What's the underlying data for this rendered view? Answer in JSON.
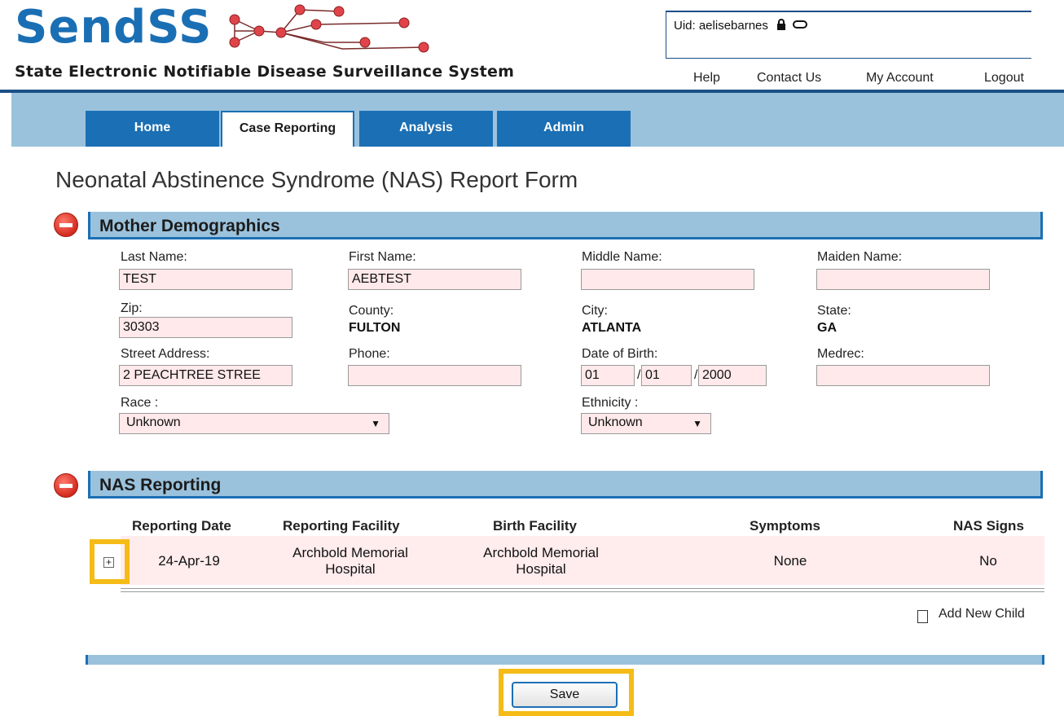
{
  "header": {
    "logo_text": "SendSS",
    "logo_subtitle": "State Electronic Notifiable Disease Surveillance System",
    "uid_label": "Uid: aelisebarnes",
    "links": [
      "Help",
      "Contact Us",
      "My Account",
      "Logout"
    ]
  },
  "nav": {
    "tabs": [
      {
        "label": "Home",
        "active": false
      },
      {
        "label": "Case Reporting",
        "active": true
      },
      {
        "label": "Analysis",
        "active": false
      },
      {
        "label": "Admin",
        "active": false
      }
    ]
  },
  "page": {
    "title": "Neonatal Abstinence Syndrome (NAS) Report Form"
  },
  "mother": {
    "section_title": "Mother Demographics",
    "last_name_label": "Last Name:",
    "last_name": "TEST",
    "first_name_label": "First Name:",
    "first_name": "AEBTEST",
    "middle_name_label": "Middle Name:",
    "middle_name": "",
    "maiden_name_label": "Maiden Name:",
    "maiden_name": "",
    "zip_label": "Zip:",
    "zip": "30303",
    "county_label": "County:",
    "county": "FULTON",
    "city_label": "City:",
    "city": "ATLANTA",
    "state_label": "State:",
    "state": "GA",
    "street_label": "Street Address:",
    "street": "2 PEACHTREE STREE",
    "phone_label": "Phone:",
    "phone": "",
    "dob_label": "Date of Birth:",
    "dob_month": "01",
    "dob_day": "01",
    "dob_year": "2000",
    "dob_sep": "/",
    "medrec_label": "Medrec:",
    "medrec": "",
    "race_label": "Race :",
    "race": "Unknown",
    "ethnicity_label": "Ethnicity :",
    "ethnicity": "Unknown"
  },
  "nas": {
    "section_title": "NAS Reporting",
    "columns": [
      "Reporting Date",
      "Reporting Facility",
      "Birth Facility",
      "Symptoms",
      "NAS Signs"
    ],
    "rows": [
      {
        "reporting_date": "24-Apr-19",
        "reporting_facility_l1": "Archbold Memorial",
        "reporting_facility_l2": "Hospital",
        "birth_facility_l1": "Archbold Memorial",
        "birth_facility_l2": "Hospital",
        "symptoms": "None",
        "nas_signs": "No"
      }
    ],
    "expand_glyph": "+",
    "add_child_label": "Add New Child"
  },
  "footer": {
    "save_label": "Save"
  },
  "colors": {
    "brand_blue": "#1b6fb4",
    "bar_blue": "#9bc2dc",
    "highlight": "#f5bb17",
    "input_bg": "#ffe9ea"
  },
  "icons": [
    "lock-icon",
    "refresh-icon",
    "minus-circle-icon",
    "expand-icon",
    "document-icon"
  ]
}
